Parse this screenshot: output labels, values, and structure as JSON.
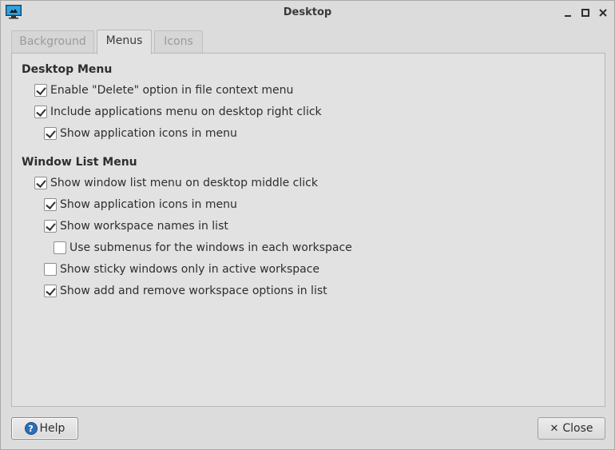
{
  "window": {
    "title": "Desktop",
    "minimize_glyph": "▁",
    "maximize_glyph": "□",
    "close_glyph": "✕"
  },
  "tabs": [
    {
      "label": "Background",
      "active": false
    },
    {
      "label": "Menus",
      "active": true
    },
    {
      "label": "Icons",
      "active": false
    }
  ],
  "desktop_menu": {
    "title": "Desktop Menu",
    "options": [
      {
        "label": "Enable \"Delete\" option in file context menu",
        "checked": true
      },
      {
        "label": "Include applications menu on desktop right click",
        "checked": true
      },
      {
        "label": "Show application icons in menu",
        "checked": true
      }
    ]
  },
  "window_list_menu": {
    "title": "Window List Menu",
    "options": [
      {
        "label": "Show window list menu on desktop middle click",
        "checked": true
      },
      {
        "label": "Show application icons in menu",
        "checked": true
      },
      {
        "label": "Show workspace names in list",
        "checked": true
      },
      {
        "label": "Use submenus for the windows in each workspace",
        "checked": false
      },
      {
        "label": "Show sticky windows only in active workspace",
        "checked": false
      },
      {
        "label": "Show add and remove workspace options in list",
        "checked": true
      }
    ]
  },
  "buttons": {
    "help_label": "Help",
    "help_glyph": "?",
    "close_label": "Close",
    "close_glyph": "✕"
  },
  "colors": {
    "window_bg": "#dcdcdc",
    "panel_bg": "#e2e2e2",
    "help_icon": "#2d6fb5"
  }
}
